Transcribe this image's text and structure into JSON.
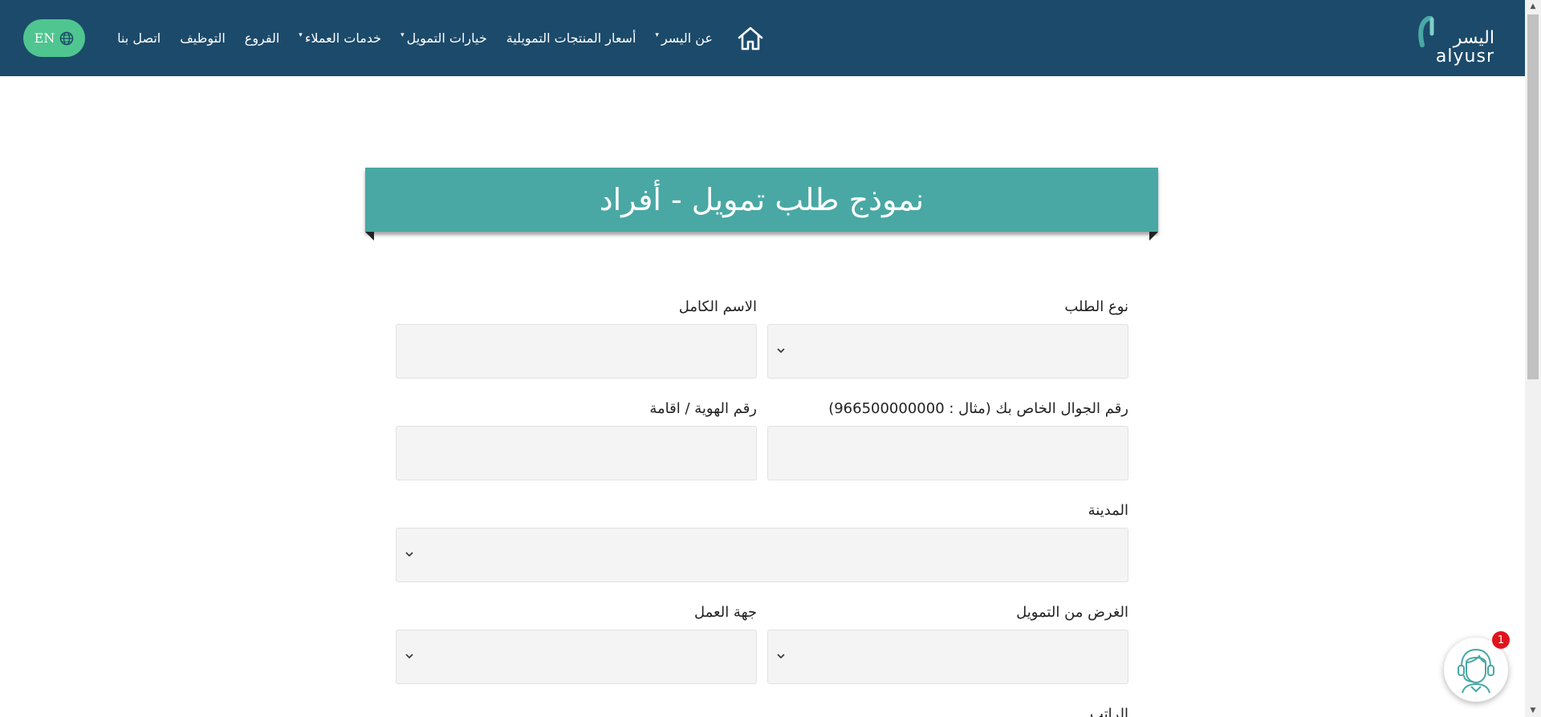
{
  "header": {
    "logo_ar": "اليسر",
    "logo_en": "alyusr",
    "nav": [
      {
        "label": "عن اليسر",
        "dropdown": true
      },
      {
        "label": "أسعار المنتجات التمويلية",
        "dropdown": false
      },
      {
        "label": "خيارات التمويل",
        "dropdown": true
      },
      {
        "label": "خدمات العملاء",
        "dropdown": true
      },
      {
        "label": "الفروع",
        "dropdown": false
      },
      {
        "label": "التوظيف",
        "dropdown": false
      },
      {
        "label": "اتصل بنا",
        "dropdown": false
      }
    ],
    "lang_label": "EN"
  },
  "form": {
    "title": "نموذج طلب تمويل - أفراد",
    "fields": {
      "request_type": {
        "label": "نوع الطلب",
        "value": ""
      },
      "full_name": {
        "label": "الاسم الكامل",
        "value": ""
      },
      "mobile": {
        "label": "رقم الجوال الخاص بك (مثال : 966500000000)",
        "value": ""
      },
      "national_id": {
        "label": "رقم الهوية / اقامة",
        "value": ""
      },
      "city": {
        "label": "المدينة",
        "value": ""
      },
      "purpose": {
        "label": "الغرض من التمويل",
        "value": ""
      },
      "employer": {
        "label": "جهة العمل",
        "value": ""
      },
      "next_label_partial": "الراتب"
    }
  },
  "chat": {
    "badge_count": "1"
  },
  "colors": {
    "header_bg": "#1c4a6a",
    "ribbon_bg": "#49a8a4",
    "lang_btn_bg": "#4fc58f",
    "field_bg": "#f4f4f4",
    "badge_bg": "#e0141b"
  }
}
